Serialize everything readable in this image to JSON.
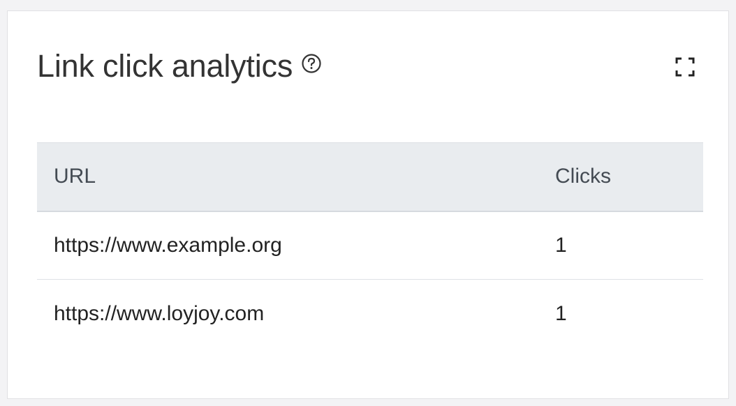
{
  "card": {
    "title": "Link click analytics",
    "help_icon": "help-circle-icon",
    "fullscreen_icon": "fullscreen-icon"
  },
  "table": {
    "columns": [
      "URL",
      "Clicks"
    ],
    "rows": [
      {
        "url": "https://www.example.org",
        "clicks": "1"
      },
      {
        "url": "https://www.loyjoy.com",
        "clicks": "1"
      }
    ]
  },
  "colors": {
    "header_bg": "#e9ecef",
    "card_bg": "#ffffff",
    "page_bg": "#f3f3f5"
  }
}
